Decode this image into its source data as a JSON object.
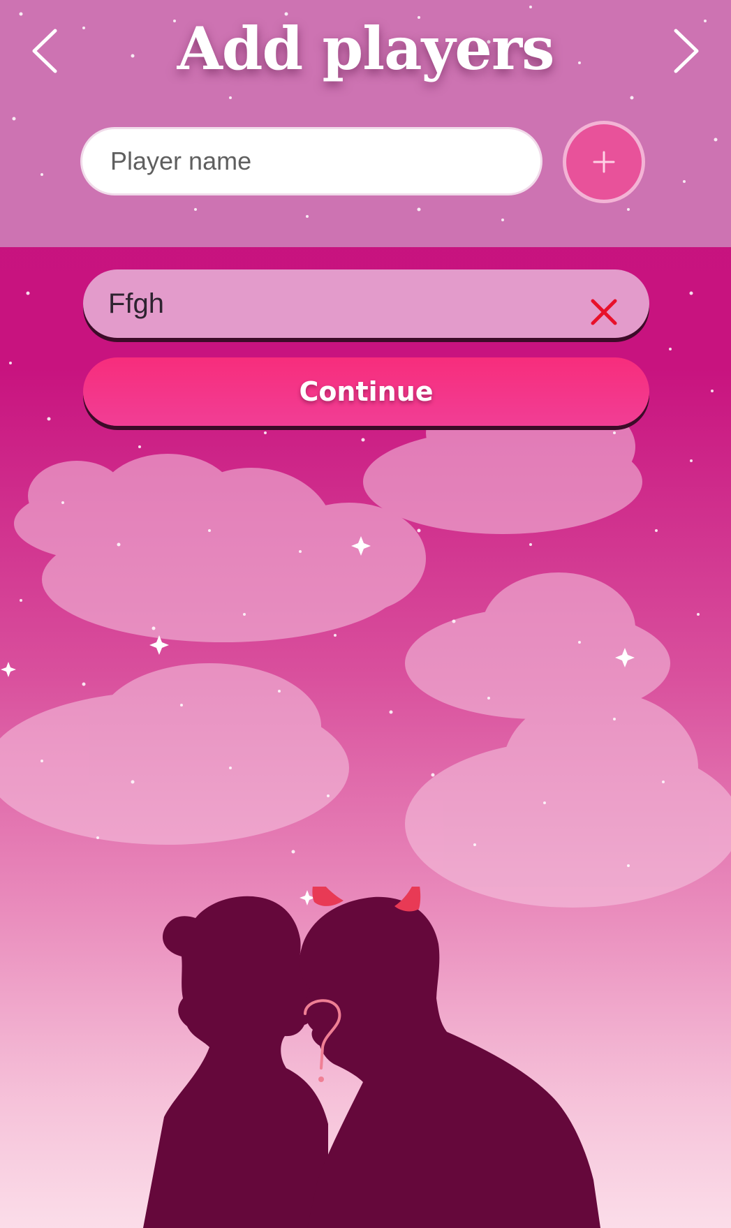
{
  "header": {
    "title": "Add players",
    "back_icon": "chevron-left-icon",
    "forward_icon": "chevron-right-icon"
  },
  "add_player": {
    "input_placeholder": "Player name",
    "input_value": "",
    "add_icon": "plus-icon"
  },
  "players": [
    {
      "name": "Ffgh",
      "remove_icon": "close-icon"
    }
  ],
  "continue_label": "Continue",
  "colors": {
    "header_band": "#cd73b2",
    "background_top": "#c6147f",
    "background_bottom": "#fbdde9",
    "accent": "#f72d7c",
    "player_row": "#e39bcb",
    "remove_icon": "#e8102a",
    "silhouette": "#65083b",
    "horns": "#e83a55"
  }
}
